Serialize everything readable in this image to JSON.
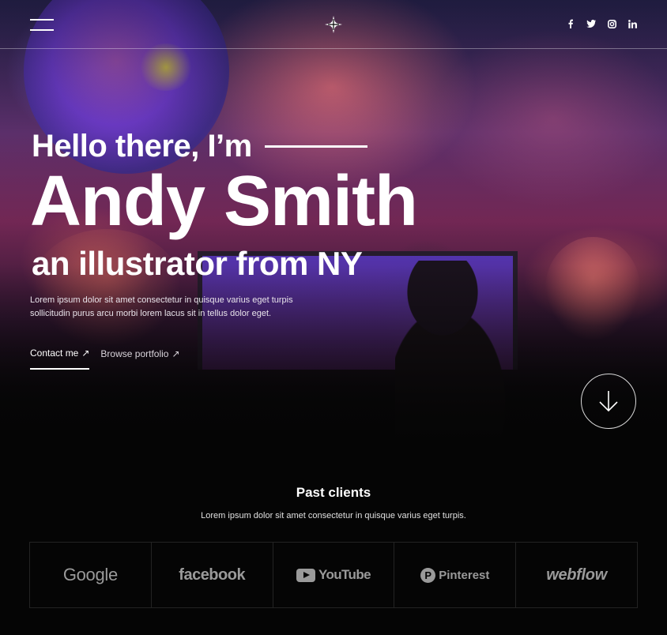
{
  "nav": {
    "menu_icon": "hamburger-menu-icon",
    "logo_icon": "diamond-star-logo",
    "socials": [
      "facebook-icon",
      "twitter-icon",
      "instagram-icon",
      "linkedin-icon"
    ]
  },
  "hero": {
    "greeting": "Hello there, I’m",
    "name": "Andy Smith",
    "subtitle": "an illustrator from NY",
    "description": "Lorem ipsum dolor sit amet consectetur in quisque varius eget turpis sollicitudin purus arcu morbi lorem lacus sit in tellus dolor eget.",
    "contact_label": "Contact me",
    "portfolio_label": "Browse portfolio",
    "arrow": "↗",
    "scroll_icon": "arrow-down-icon"
  },
  "clients": {
    "title": "Past clients",
    "description": "Lorem ipsum dolor sit amet consectetur in quisque varius eget turpis.",
    "logos": [
      "Google",
      "facebook",
      "YouTube",
      "Pinterest",
      "webflow"
    ]
  },
  "colors": {
    "background": "#050505",
    "text": "#ffffff",
    "logo_gray": "#9a9a9a"
  }
}
